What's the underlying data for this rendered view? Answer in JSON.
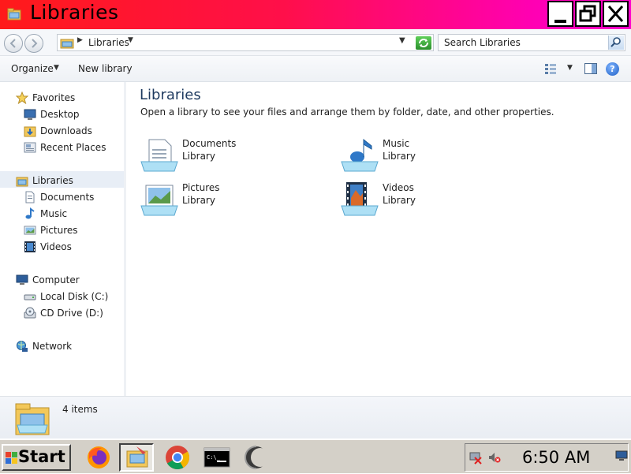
{
  "window": {
    "title": "Libraries",
    "controls": {
      "minimize": "minimize",
      "maximize": "maximize",
      "close": "close"
    }
  },
  "address_bar": {
    "path": "Libraries",
    "search_placeholder": "Search Libraries"
  },
  "command_bar": {
    "organize": "Organize",
    "new_library": "New library"
  },
  "sidebar": {
    "favorites": {
      "label": "Favorites",
      "items": [
        "Desktop",
        "Downloads",
        "Recent Places"
      ]
    },
    "libraries": {
      "label": "Libraries",
      "items": [
        "Documents",
        "Music",
        "Pictures",
        "Videos"
      ]
    },
    "computer": {
      "label": "Computer",
      "items": [
        "Local Disk (C:)",
        "CD Drive (D:)"
      ]
    },
    "network": {
      "label": "Network"
    }
  },
  "content": {
    "title": "Libraries",
    "description": "Open a library to see your files and arrange them by folder, date, and other properties.",
    "libraries": [
      {
        "name": "Documents",
        "type": "Library",
        "icon": "documents-library-icon"
      },
      {
        "name": "Music",
        "type": "Library",
        "icon": "music-library-icon"
      },
      {
        "name": "Pictures",
        "type": "Library",
        "icon": "pictures-library-icon"
      },
      {
        "name": "Videos",
        "type": "Library",
        "icon": "videos-library-icon"
      }
    ]
  },
  "details_pane": {
    "item_count": "4 items"
  },
  "taskbar": {
    "start_label": "Start",
    "apps": [
      "firefox-icon",
      "libraries-explorer-icon",
      "chrome-icon",
      "command-prompt-icon",
      "moon-app-icon"
    ],
    "clock": "6:50 AM"
  },
  "colors": {
    "title_gradient_start": "#ff1a1a",
    "title_gradient_end": "#ff00cc",
    "taskbar_bg": "#d4d0c8",
    "selected_nav_bg": "#e8eef6",
    "heading_color": "#1e3a5f"
  }
}
